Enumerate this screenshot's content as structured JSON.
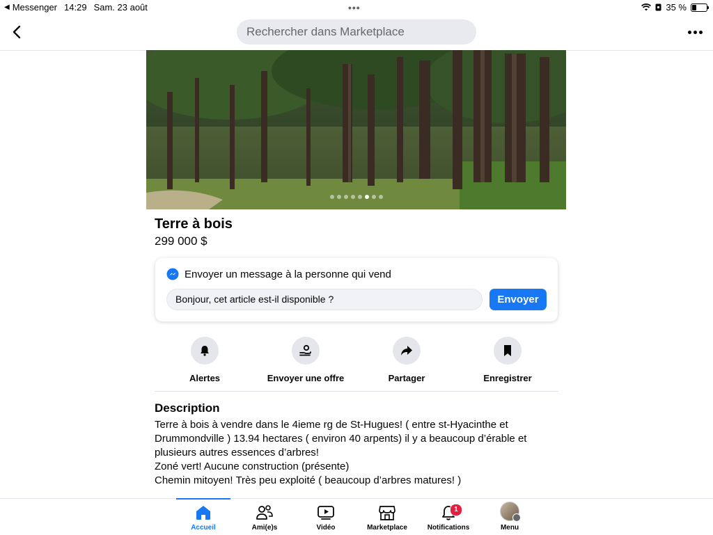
{
  "status_bar": {
    "back_app": "Messenger",
    "time": "14:29",
    "date": "Sam. 23 août",
    "battery": "35 %",
    "battery_level": 0.35
  },
  "top_bar": {
    "search_placeholder": "Rechercher dans Marketplace"
  },
  "listing": {
    "photo_count": 8,
    "active_photo_index": 5,
    "title": "Terre à bois",
    "price": "299 000 $"
  },
  "message_card": {
    "heading": "Envoyer un message à la personne qui vend",
    "input_value": "Bonjour, cet article est-il disponible ?",
    "send_label": "Envoyer"
  },
  "actions": [
    {
      "label": "Alertes",
      "icon": "bell-icon"
    },
    {
      "label": "Envoyer une offre",
      "icon": "offer-icon"
    },
    {
      "label": "Partager",
      "icon": "share-icon"
    },
    {
      "label": "Enregistrer",
      "icon": "bookmark-icon"
    }
  ],
  "description": {
    "title": "Description",
    "lines": [
      "Terre à bois à vendre dans le 4ieme rg de St-Hugues! ( entre st-Hyacinthe et",
      "Drummondville ) 13.94 hectares ( environ 40 arpents) il y a beaucoup d’érable et",
      "plusieurs autres essences d’arbres!",
      "Zoné vert! Aucune construction (présente)",
      "Chemin mitoyen! Très peu exploité ( beaucoup d’arbres matures! )"
    ]
  },
  "bottom_nav": {
    "items": [
      {
        "label": "Accueil",
        "icon": "home-icon",
        "active": true
      },
      {
        "label": "Ami(e)s",
        "icon": "friends-icon"
      },
      {
        "label": "Vidéo",
        "icon": "video-icon"
      },
      {
        "label": "Marketplace",
        "icon": "marketplace-icon"
      },
      {
        "label": "Notifications",
        "icon": "bell-icon",
        "badge": "1"
      },
      {
        "label": "Menu",
        "icon": "avatar"
      }
    ]
  },
  "colors": {
    "accent": "#1877f2",
    "badge": "#e41e3f",
    "search_bg": "#e8eaf0"
  }
}
